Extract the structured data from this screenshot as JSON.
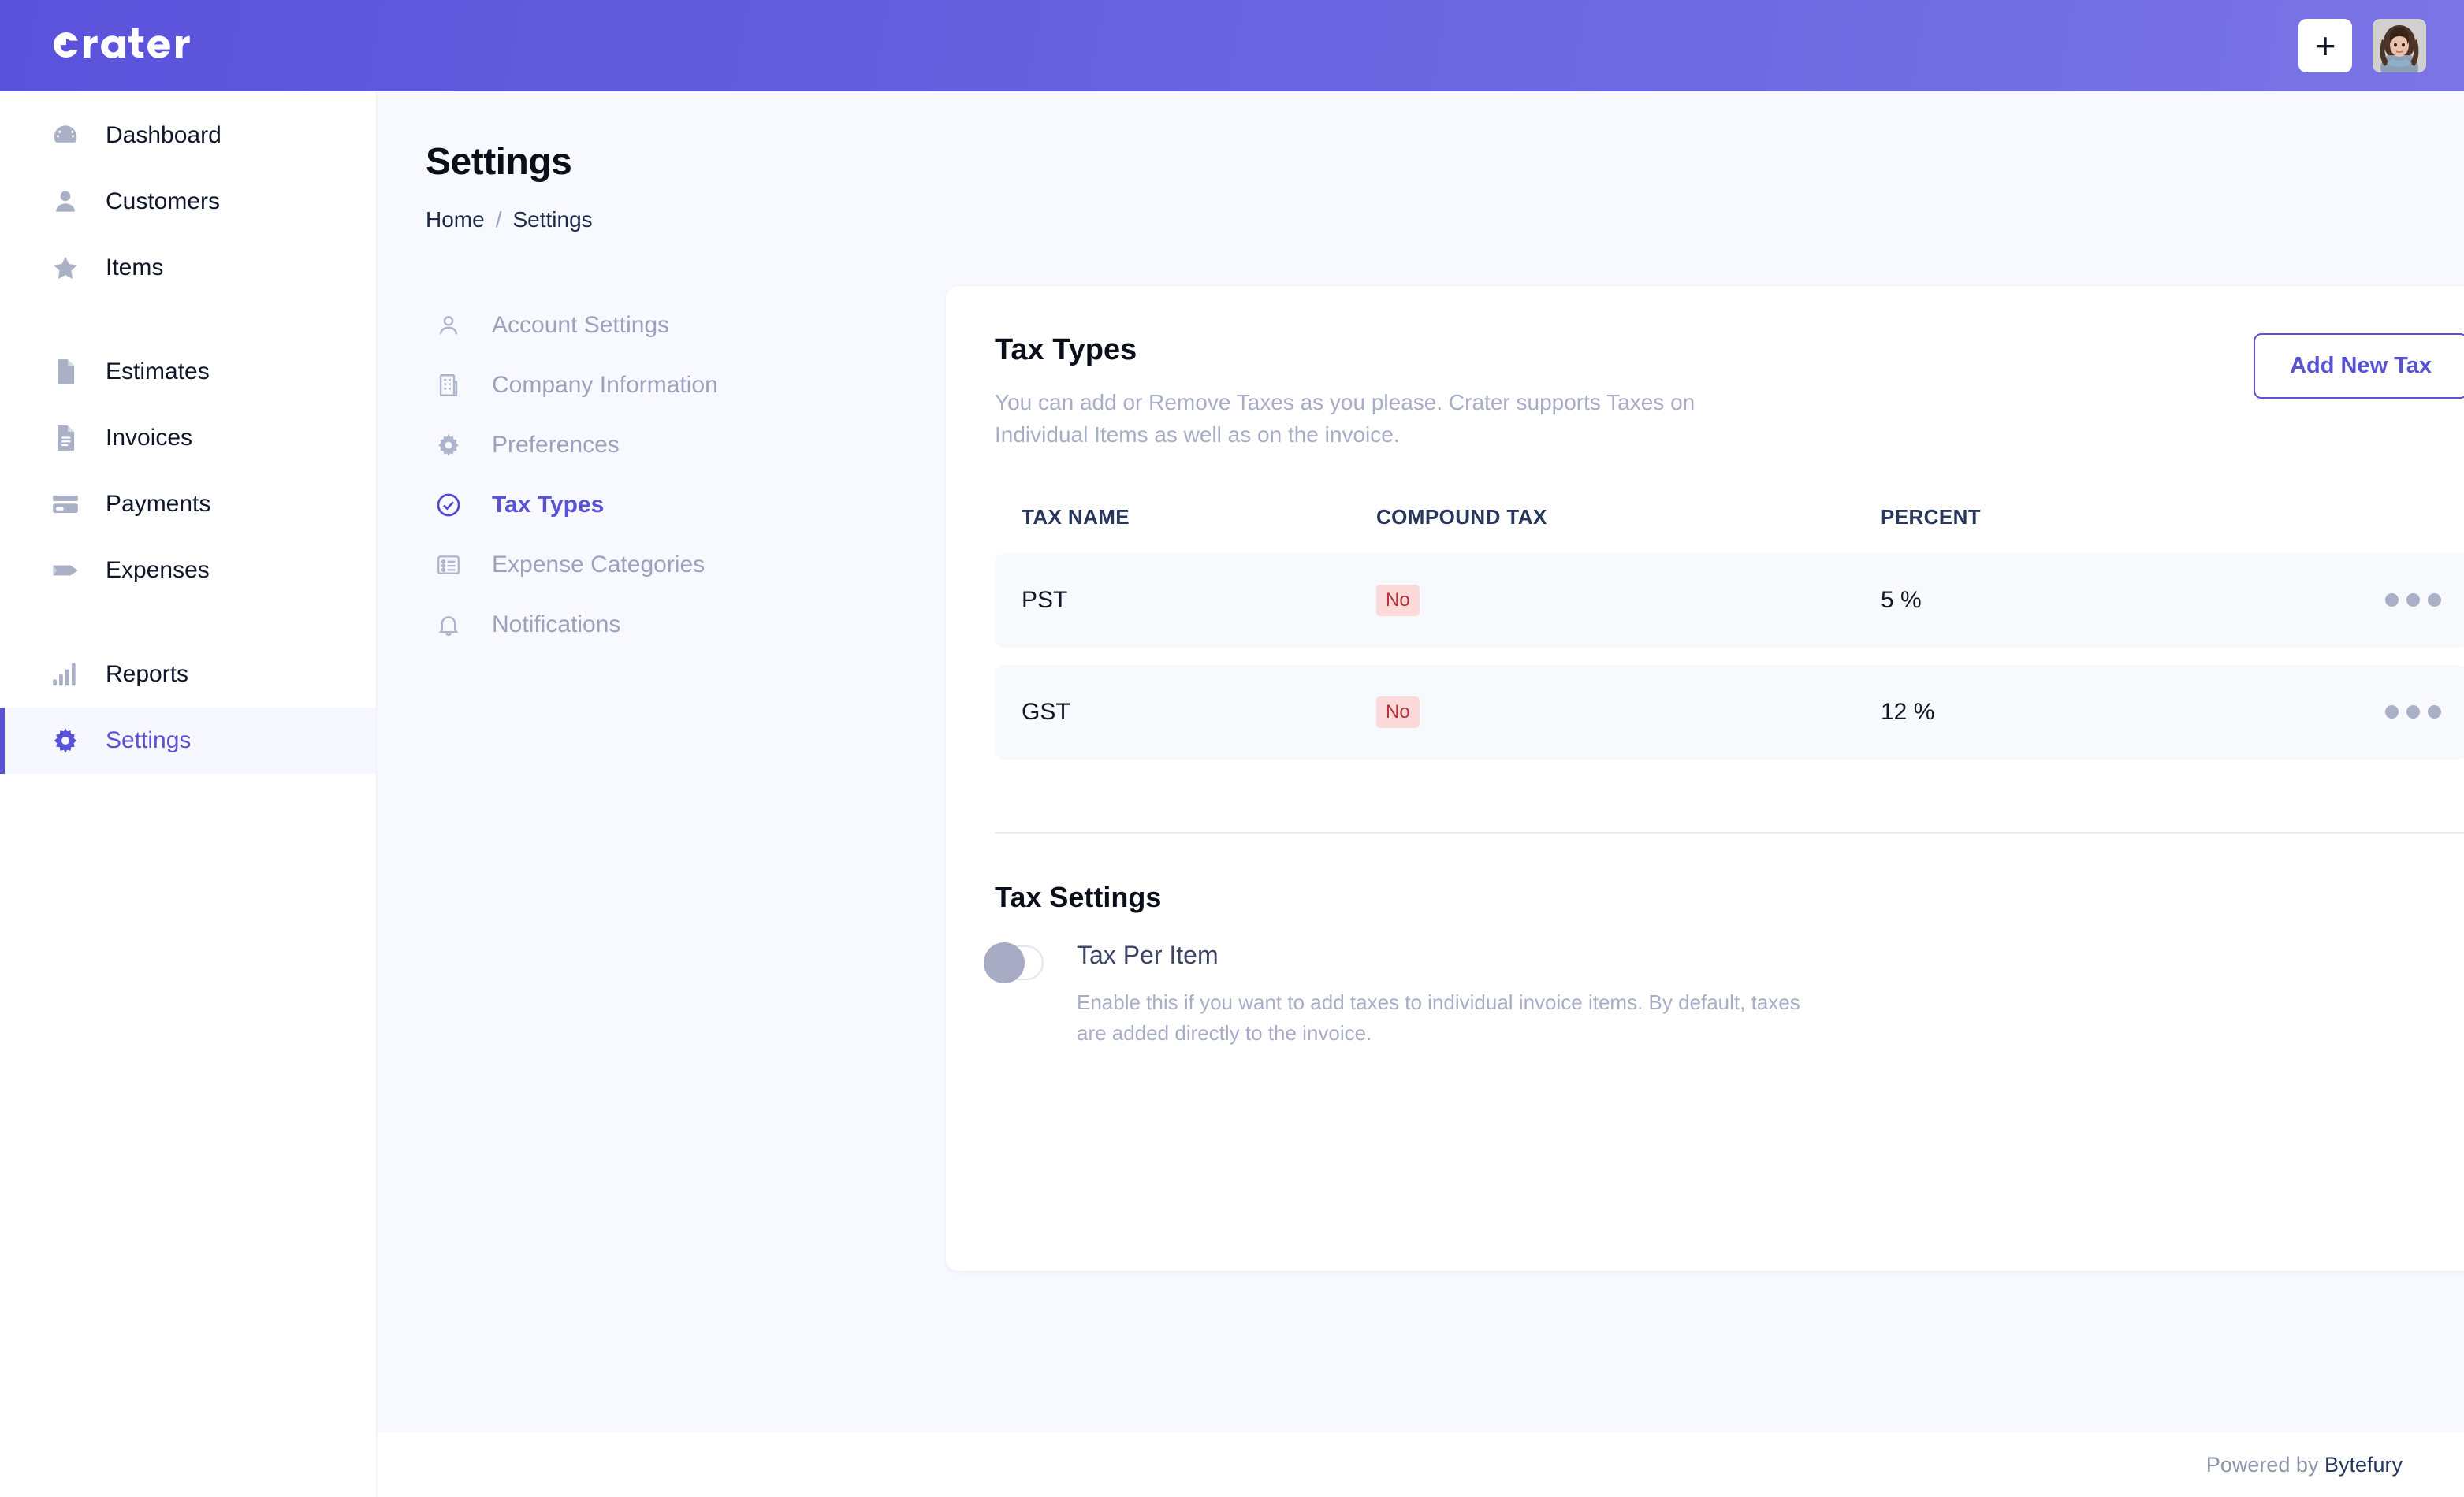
{
  "topbar": {
    "logo_text": "crater",
    "add_button_label": "+",
    "avatar_label": "user-avatar"
  },
  "sidebar": {
    "groups": [
      {
        "items": [
          {
            "label": "Dashboard",
            "icon": "speedometer-icon",
            "active": false
          },
          {
            "label": "Customers",
            "icon": "user-icon",
            "active": false
          },
          {
            "label": "Items",
            "icon": "star-icon",
            "active": false
          }
        ]
      },
      {
        "items": [
          {
            "label": "Estimates",
            "icon": "document-icon",
            "active": false
          },
          {
            "label": "Invoices",
            "icon": "invoice-icon",
            "active": false
          },
          {
            "label": "Payments",
            "icon": "credit-card-icon",
            "active": false
          },
          {
            "label": "Expenses",
            "icon": "paper-plane-icon",
            "active": false
          }
        ]
      },
      {
        "items": [
          {
            "label": "Reports",
            "icon": "bar-chart-icon",
            "active": false
          },
          {
            "label": "Settings",
            "icon": "gear-icon",
            "active": true
          }
        ]
      }
    ]
  },
  "page": {
    "title": "Settings",
    "breadcrumb": [
      "Home",
      "Settings"
    ],
    "breadcrumb_separator": "/"
  },
  "settings_nav": [
    {
      "label": "Account Settings",
      "icon": "user-outline-icon",
      "active": false
    },
    {
      "label": "Company Information",
      "icon": "building-icon",
      "active": false
    },
    {
      "label": "Preferences",
      "icon": "gear-icon",
      "active": false
    },
    {
      "label": "Tax Types",
      "icon": "check-circle-icon",
      "active": true
    },
    {
      "label": "Expense Categories",
      "icon": "list-icon",
      "active": false
    },
    {
      "label": "Notifications",
      "icon": "bell-icon",
      "active": false
    }
  ],
  "card": {
    "title": "Tax Types",
    "description": "You can add or Remove Taxes as you please. Crater supports Taxes on Individual Items as well as on the invoice.",
    "add_new_tax_label": "Add New Tax"
  },
  "table": {
    "headers": {
      "name": "TAX NAME",
      "compound": "COMPOUND TAX",
      "percent": "PERCENT"
    },
    "rows": [
      {
        "name": "PST",
        "compound": "No",
        "percent": "5 %",
        "actions": "more-actions"
      },
      {
        "name": "GST",
        "compound": "No",
        "percent": "12 %",
        "actions": "more-actions"
      }
    ]
  },
  "tax_settings": {
    "title": "Tax Settings",
    "toggle_label": "Tax Per Item",
    "toggle_state": "off",
    "description": "Enable this if you want to add taxes to individual invoice items. By default, taxes are added directly to the invoice."
  },
  "footer": {
    "prefix": "Powered by ",
    "brand": "Bytefury"
  },
  "colors": {
    "brand_purple": "#5a52d5",
    "header_gradient_start": "#5a52db",
    "header_gradient_end": "#7a74e6",
    "badge_bg": "#fbdad9",
    "badge_text": "#b4323a",
    "page_bg": "#f8f9ff",
    "row_bg": "#f8f9fd"
  }
}
